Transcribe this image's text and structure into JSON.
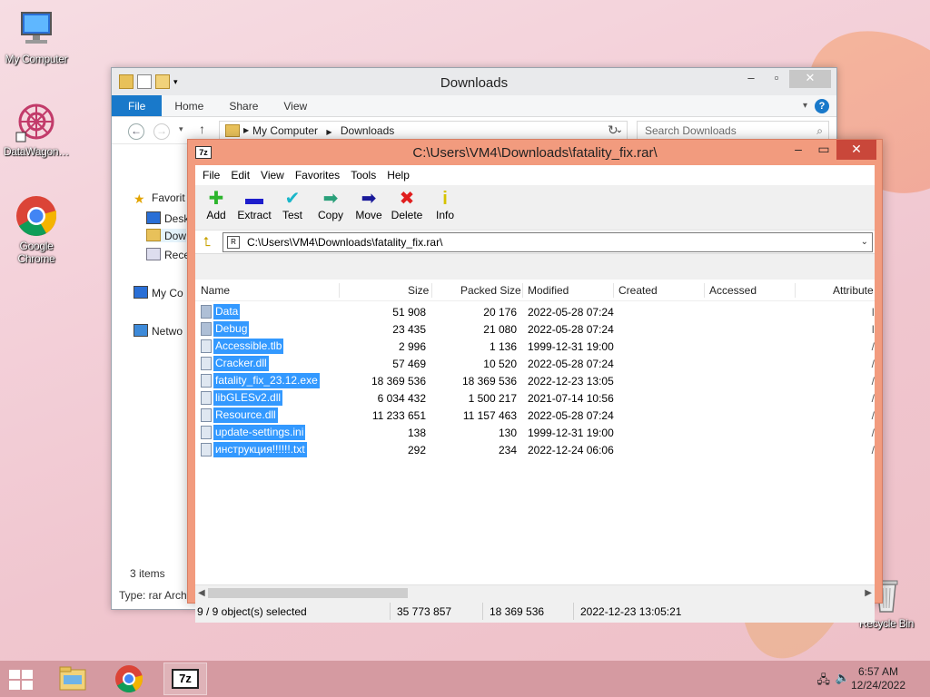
{
  "desktop": {
    "icons": [
      {
        "label": "My Computer",
        "icon": "computer-icon"
      },
      {
        "label": "DataWagon…",
        "icon": "datawagon-icon"
      },
      {
        "label": "Google Chrome",
        "icon": "chrome-icon"
      },
      {
        "label": "Recycle Bin",
        "icon": "recycle-bin-icon"
      }
    ]
  },
  "explorer": {
    "title": "Downloads",
    "tabs": [
      "File",
      "Home",
      "Share",
      "View"
    ],
    "breadcrumb": [
      "My Computer",
      "Downloads"
    ],
    "search_placeholder": "Search Downloads",
    "sidebar": [
      "Favorit",
      "Desk",
      "Dow",
      "Rece",
      "My Co",
      "Netwo"
    ],
    "status_items": "3 items",
    "status_type": "Type: rar Arch"
  },
  "zip": {
    "title": "C:\\Users\\VM4\\Downloads\\fatality_fix.rar\\",
    "logo": "7z",
    "menu": [
      "File",
      "Edit",
      "View",
      "Favorites",
      "Tools",
      "Help"
    ],
    "toolbar": [
      {
        "label": "Add",
        "icon": "add-icon",
        "color": "#2db52d"
      },
      {
        "label": "Extract",
        "icon": "extract-icon",
        "color": "#1d1dcc"
      },
      {
        "label": "Test",
        "icon": "test-icon",
        "color": "#19b6c9"
      },
      {
        "label": "Copy",
        "icon": "copy-icon",
        "color": "#2aa07a"
      },
      {
        "label": "Move",
        "icon": "move-icon",
        "color": "#1a1a9a"
      },
      {
        "label": "Delete",
        "icon": "delete-icon",
        "color": "#e01e1e"
      },
      {
        "label": "Info",
        "icon": "info-icon",
        "color": "#d6c300"
      }
    ],
    "address": "C:\\Users\\VM4\\Downloads\\fatality_fix.rar\\",
    "columns": [
      "Name",
      "Size",
      "Packed Size",
      "Modified",
      "Created",
      "Accessed",
      "Attribute"
    ],
    "rows": [
      {
        "name": "Data",
        "size": "51 908",
        "packed": "20 176",
        "modified": "2022-05-28 07:24",
        "attr": "I",
        "type": "folder"
      },
      {
        "name": "Debug",
        "size": "23 435",
        "packed": "21 080",
        "modified": "2022-05-28 07:24",
        "attr": "I",
        "type": "folder"
      },
      {
        "name": "Accessible.tlb",
        "size": "2 996",
        "packed": "1 136",
        "modified": "1999-12-31 19:00",
        "attr": "/",
        "type": "file"
      },
      {
        "name": "Cracker.dll",
        "size": "57 469",
        "packed": "10 520",
        "modified": "2022-05-28 07:24",
        "attr": "/",
        "type": "dll"
      },
      {
        "name": "fatality_fix_23.12.exe",
        "size": "18 369 536",
        "packed": "18 369 536",
        "modified": "2022-12-23 13:05",
        "attr": "/",
        "type": "exe"
      },
      {
        "name": "libGLESv2.dll",
        "size": "6 034 432",
        "packed": "1 500 217",
        "modified": "2021-07-14 10:56",
        "attr": "/",
        "type": "dll"
      },
      {
        "name": "Resource.dll",
        "size": "11 233 651",
        "packed": "11 157 463",
        "modified": "2022-05-28 07:24",
        "attr": "/",
        "type": "dll"
      },
      {
        "name": "update-settings.ini",
        "size": "138",
        "packed": "130",
        "modified": "1999-12-31 19:00",
        "attr": "/",
        "type": "ini"
      },
      {
        "name": "инструкция!!!!!!.txt",
        "size": "292",
        "packed": "234",
        "modified": "2022-12-24 06:06",
        "attr": "/",
        "type": "file"
      }
    ],
    "status": {
      "selected": "9 / 9 object(s) selected",
      "size": "35 773 857",
      "packed": "18 369 536",
      "modified": "2022-12-23 13:05:21"
    }
  },
  "taskbar": {
    "time": "6:57 AM",
    "date": "12/24/2022",
    "apps": [
      "file-explorer-icon",
      "chrome-icon",
      "7zip-icon"
    ],
    "zip_label": "7z"
  }
}
